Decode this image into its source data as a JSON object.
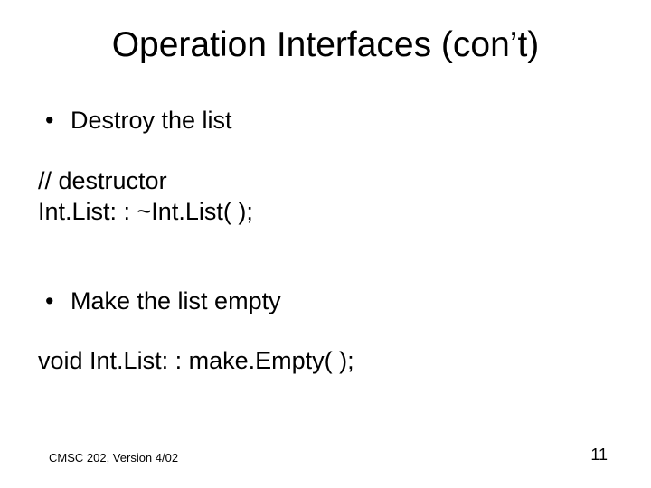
{
  "title": "Operation Interfaces (con’t)",
  "bullets": [
    {
      "label": "Destroy the list"
    },
    {
      "label": "Make the list empty"
    }
  ],
  "code": {
    "destructor_comment": "// destructor",
    "destructor_sig": "Int.List: : ~Int.List( );",
    "make_empty_sig": "void Int.List: : make.Empty( );"
  },
  "footer": {
    "left": "CMSC 202, Version 4/02",
    "page": "11"
  }
}
